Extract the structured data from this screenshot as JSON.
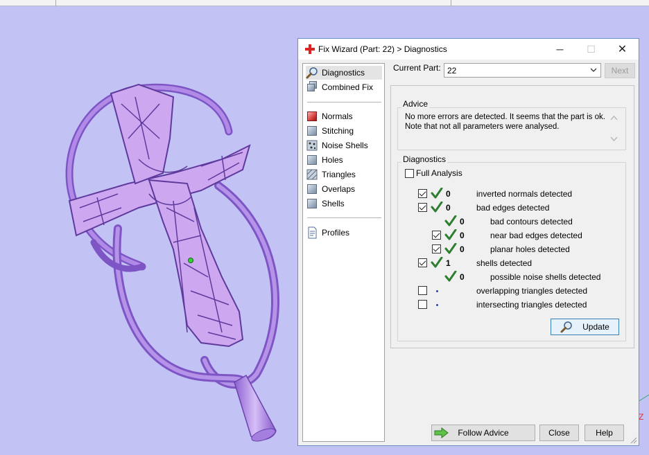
{
  "window": {
    "title": "Fix Wizard (Part: 22) > Diagnostics",
    "minimize": "─",
    "maximize": "☐",
    "close": "✕"
  },
  "nav": {
    "items": [
      {
        "label": "Diagnostics",
        "icon": "magnifier-icon"
      },
      {
        "label": "Combined Fix",
        "icon": "stack-icon"
      },
      {
        "label": "Normals",
        "icon": "normals-cube-icon"
      },
      {
        "label": "Stitching",
        "icon": "stitching-cube-icon"
      },
      {
        "label": "Noise Shells",
        "icon": "noise-shells-cube-icon"
      },
      {
        "label": "Holes",
        "icon": "holes-cube-icon"
      },
      {
        "label": "Triangles",
        "icon": "triangles-cube-icon"
      },
      {
        "label": "Overlaps",
        "icon": "overlaps-cube-icon"
      },
      {
        "label": "Shells",
        "icon": "shells-cube-icon"
      },
      {
        "label": "Profiles",
        "icon": "document-icon"
      }
    ]
  },
  "current_part": {
    "label": "Current Part:",
    "value": "22",
    "next_label": "Next"
  },
  "advice": {
    "legend": "Advice",
    "lines": [
      "No more errors are detected. It seems that the part is ok.",
      "Note that not all parameters were analysed."
    ]
  },
  "diagnostics": {
    "legend": "Diagnostics",
    "full_analysis_label": "Full Analysis",
    "rows": [
      {
        "checked": true,
        "status": "ok",
        "count": "0",
        "text": "inverted normals detected"
      },
      {
        "checked": true,
        "status": "ok",
        "count": "0",
        "text": "bad edges detected"
      },
      {
        "checked": null,
        "status": "ok",
        "count": "0",
        "text": "bad contours detected"
      },
      {
        "checked": true,
        "status": "ok",
        "count": "0",
        "text": "near bad edges detected"
      },
      {
        "checked": true,
        "status": "ok",
        "count": "0",
        "text": "planar holes detected"
      },
      {
        "checked": true,
        "status": "ok",
        "count": "1",
        "text": "shells detected"
      },
      {
        "checked": null,
        "status": "ok",
        "count": "0",
        "text": "possible noise shells detected"
      },
      {
        "checked": false,
        "status": "none",
        "count": "",
        "text": "overlapping triangles detected"
      },
      {
        "checked": false,
        "status": "none",
        "count": "",
        "text": "intersecting triangles detected"
      }
    ],
    "update_label": "Update"
  },
  "footer": {
    "follow_label": "Follow Advice",
    "close_label": "Close",
    "help_label": "Help"
  },
  "viewport": {
    "axis_label": "Z",
    "model_color": "#b48be6"
  }
}
